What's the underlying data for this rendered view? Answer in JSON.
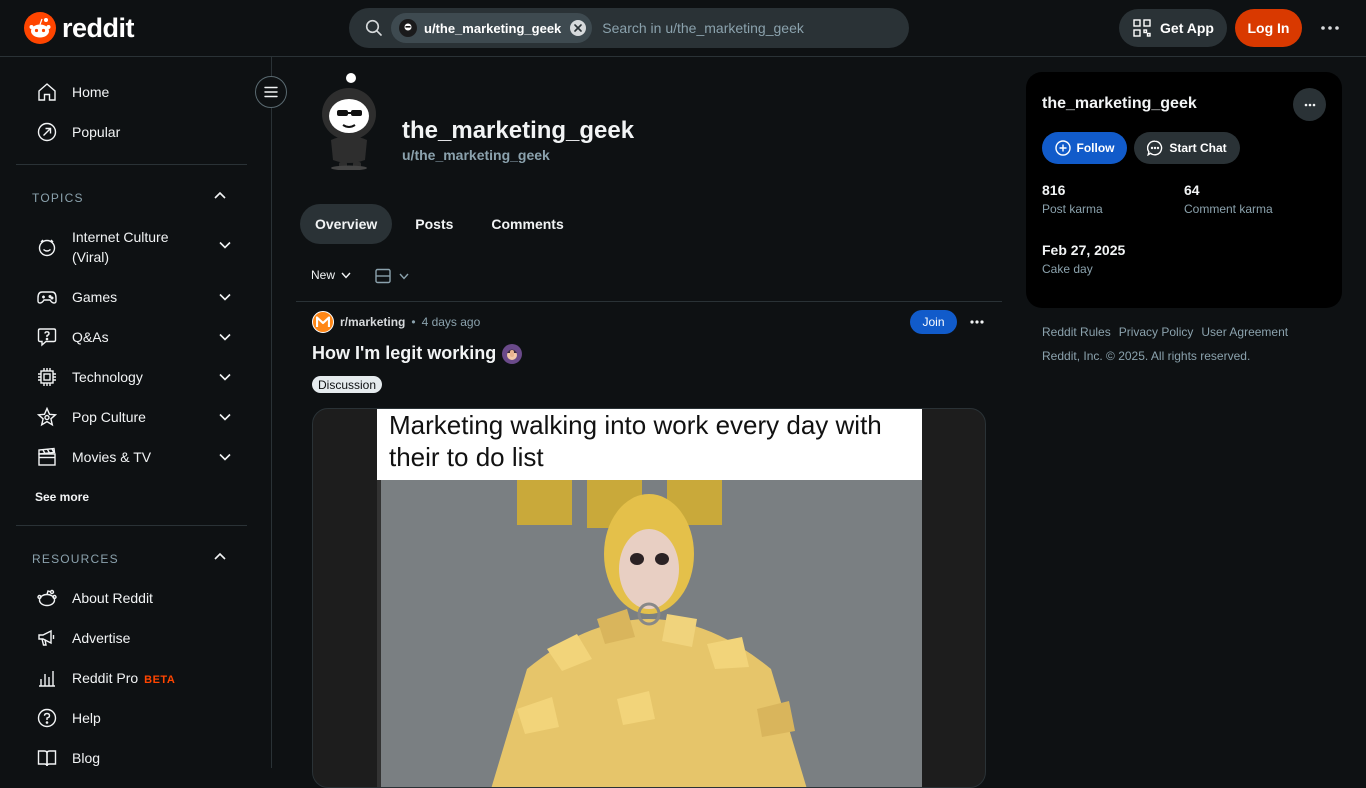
{
  "header": {
    "logo_text": "reddit",
    "search_chip_label": "u/the_marketing_geek",
    "search_placeholder": "Search in u/the_marketing_geek",
    "get_app_label": "Get App",
    "login_label": "Log In"
  },
  "sidebar": {
    "home": "Home",
    "popular": "Popular",
    "topics_title": "TOPICS",
    "topics": [
      {
        "label": "Internet Culture (Viral)",
        "icon": "smile-icon"
      },
      {
        "label": "Games",
        "icon": "gamepad-icon"
      },
      {
        "label": "Q&As",
        "icon": "question-bubble-icon"
      },
      {
        "label": "Technology",
        "icon": "chip-icon"
      },
      {
        "label": "Pop Culture",
        "icon": "star-icon"
      },
      {
        "label": "Movies & TV",
        "icon": "clapperboard-icon"
      }
    ],
    "see_more": "See more",
    "resources_title": "RESOURCES",
    "resources": [
      {
        "label": "About Reddit",
        "icon": "snoo-icon"
      },
      {
        "label": "Advertise",
        "icon": "megaphone-icon"
      },
      {
        "label": "Reddit Pro",
        "icon": "bar-chart-icon",
        "badge": "BETA"
      },
      {
        "label": "Help",
        "icon": "help-icon"
      },
      {
        "label": "Blog",
        "icon": "book-icon"
      }
    ]
  },
  "profile": {
    "display_name": "the_marketing_geek",
    "handle": "u/the_marketing_geek",
    "tabs": [
      "Overview",
      "Posts",
      "Comments"
    ],
    "sort_label": "New"
  },
  "post": {
    "subreddit": "r/marketing",
    "separator": "•",
    "time": "4 days ago",
    "join_label": "Join",
    "title": "How I'm legit working",
    "flair": "Discussion",
    "image_caption": "Marketing walking into work every day with their to do list"
  },
  "rail": {
    "name": "the_marketing_geek",
    "follow_label": "Follow",
    "chat_label": "Start Chat",
    "post_karma": "816",
    "post_karma_label": "Post karma",
    "comment_karma": "64",
    "comment_karma_label": "Comment karma",
    "cake_day": "Feb 27, 2025",
    "cake_day_label": "Cake day",
    "footer_links": [
      "Reddit Rules",
      "Privacy Policy",
      "User Agreement"
    ],
    "copyright": "Reddit, Inc. © 2025. All rights reserved."
  },
  "colors": {
    "brand": "#ff4500",
    "login": "#d93900",
    "accent_blue": "#115bca",
    "background": "#0e1113"
  }
}
